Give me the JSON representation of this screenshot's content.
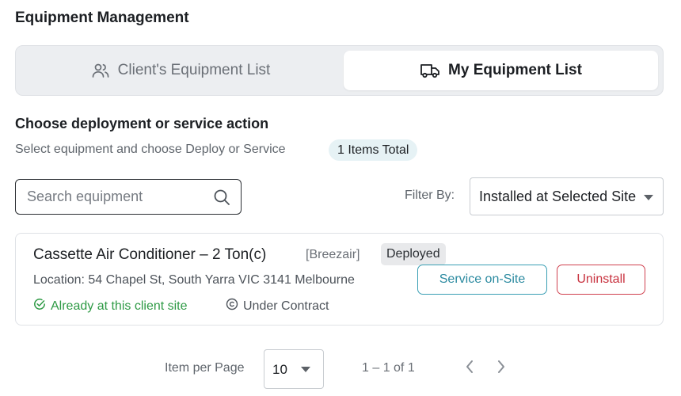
{
  "page": {
    "title": "Equipment Management"
  },
  "tabs": [
    {
      "label": "Client's Equipment List",
      "icon": "users-icon",
      "active": false
    },
    {
      "label": "My Equipment List",
      "icon": "truck-icon",
      "active": true
    }
  ],
  "section": {
    "heading": "Choose deployment or service action",
    "subtitle": "Select equipment and choose Deploy or Service",
    "count_badge": "1 Items Total"
  },
  "search": {
    "placeholder": "Search equipment",
    "value": ""
  },
  "filter": {
    "label": "Filter By:",
    "selected": "Installed at Selected Site"
  },
  "equipment": [
    {
      "name": "Cassette Air Conditioner – 2 Ton(c)",
      "brand": "[Breezair]",
      "status": "Deployed",
      "location": "Location: 54 Chapel St, South Yarra VIC 3141 Melbourne",
      "site_status": "Already at this client site",
      "contract": "Under Contract",
      "actions": {
        "service": "Service on-Site",
        "uninstall": "Uninstall"
      }
    }
  ],
  "pagination": {
    "items_per_page_label": "Item per Page",
    "page_size": "10",
    "range": "1 – 1 of 1"
  },
  "colors": {
    "service_accent": "#3a9fb4",
    "uninstall_accent": "#d0414f",
    "success_green": "#2e9a45",
    "badge_bg": "#e6f2f5"
  }
}
